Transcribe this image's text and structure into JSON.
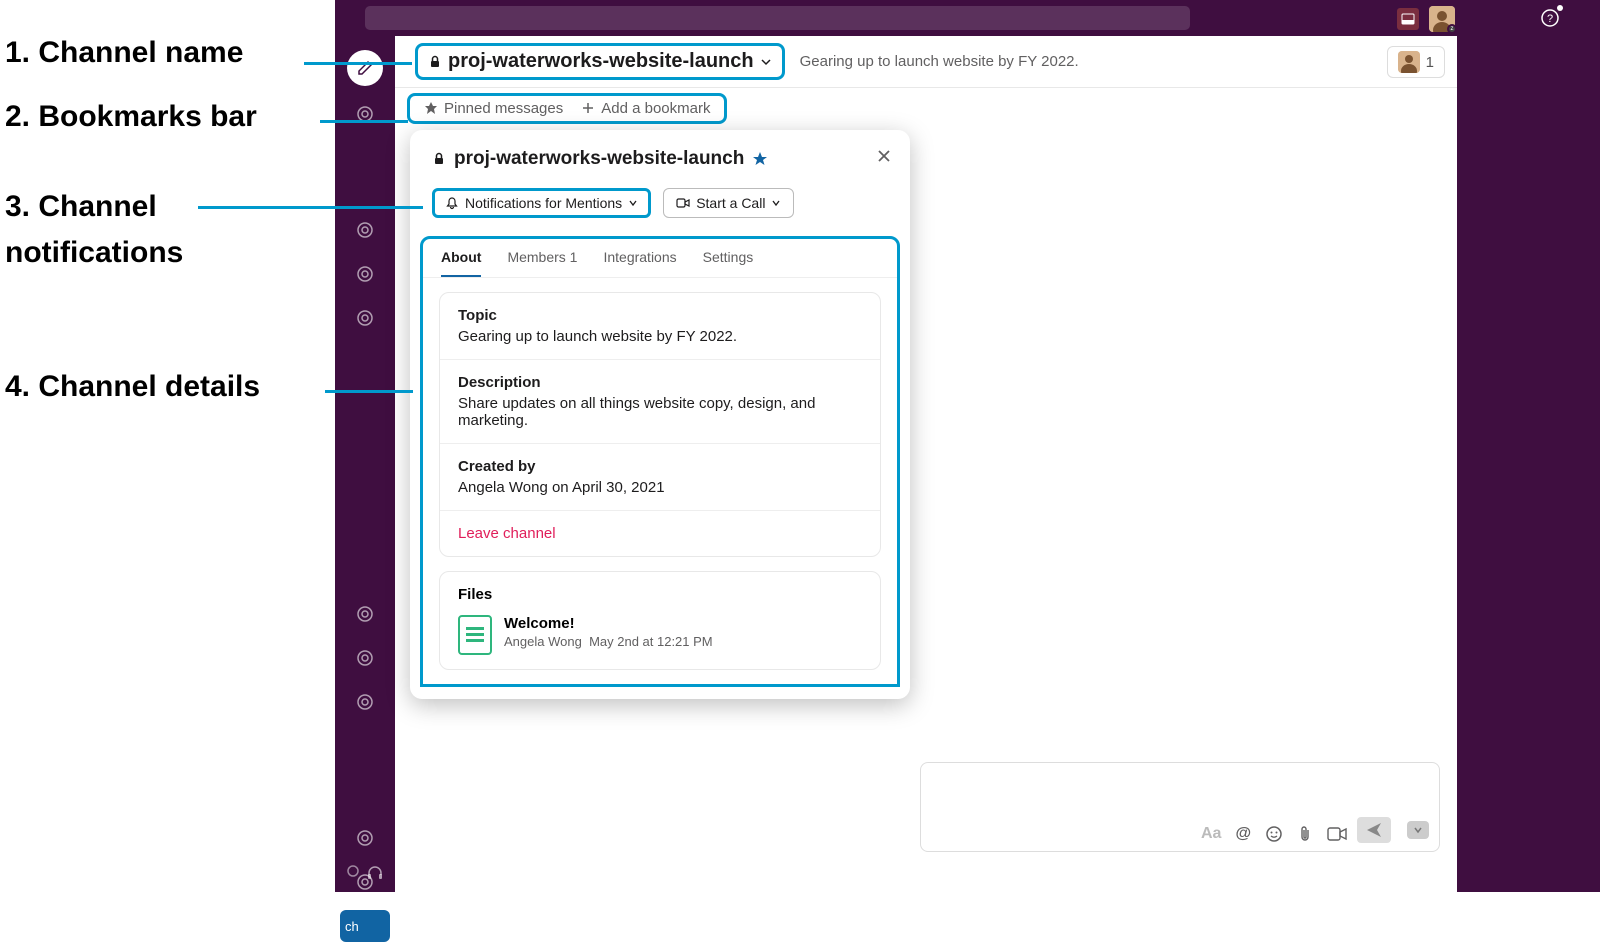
{
  "annotations": {
    "a1": "1. Channel name",
    "a2": "2. Bookmarks bar",
    "a3_line1": "3. Channel",
    "a3_line2": "notifications",
    "a4": "4. Channel details"
  },
  "header": {
    "channel_name": "proj-waterworks-website-launch",
    "topic": "Gearing up to launch website by FY 2022.",
    "member_count": "1"
  },
  "bookmarks": {
    "pinned": "Pinned messages",
    "add": "Add a bookmark"
  },
  "details": {
    "title": "proj-waterworks-website-launch",
    "notifications_btn": "Notifications for Mentions",
    "call_btn": "Start a Call",
    "tabs": {
      "about": "About",
      "members": "Members 1",
      "integrations": "Integrations",
      "settings": "Settings"
    },
    "about": {
      "topic_label": "Topic",
      "topic_value": "Gearing up to launch website by FY 2022.",
      "desc_label": "Description",
      "desc_value": "Share updates on all things website copy, design, and marketing.",
      "created_label": "Created by",
      "created_value": "Angela Wong on April 30, 2021",
      "leave": "Leave channel"
    },
    "files": {
      "heading": "Files",
      "file_title": "Welcome!",
      "file_author": "Angela Wong",
      "file_time": "May 2nd at 12:21 PM"
    }
  },
  "sidebar": {
    "active_item": "ch"
  },
  "composer": {
    "aa": "Aa"
  }
}
